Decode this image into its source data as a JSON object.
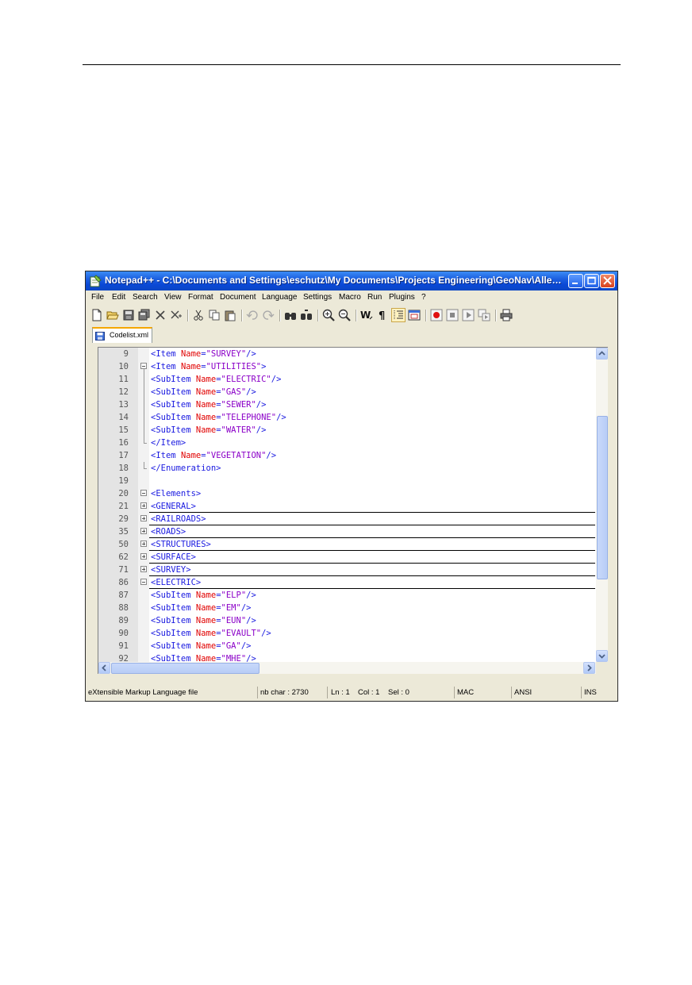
{
  "window": {
    "title": "Notepad++ - C:\\Documents and Settings\\eschutz\\My Documents\\Projects Engineering\\GeoNav\\Allen\\Man..."
  },
  "menu": [
    "File",
    "Edit",
    "Search",
    "View",
    "Format",
    "Document",
    "Language",
    "Settings",
    "Macro",
    "Run",
    "Plugins",
    "?"
  ],
  "toolbar_icons": [
    "new-icon",
    "open-icon",
    "save-icon",
    "save-all-icon",
    "close-icon",
    "close-all-icon",
    "cut-icon",
    "copy-icon",
    "paste-icon",
    "undo-icon",
    "redo-icon",
    "find-icon",
    "replace-icon",
    "zoom-in-icon",
    "zoom-out-icon",
    "wrap-icon",
    "show-all-chars-icon",
    "indent-guide-icon",
    "user-lang-icon",
    "record-macro-icon",
    "stop-record-icon",
    "play-macro-icon",
    "run-multiple-icon",
    "print-icon"
  ],
  "tab": {
    "label": "Codelist.xml"
  },
  "editor": {
    "lines": [
      {
        "n": "9",
        "indent": "",
        "tag_open": "<Item ",
        "attr": "Name",
        "eq": "=",
        "val": "\"SURVEY\"",
        "tag_close": "/>"
      },
      {
        "n": "10",
        "indent": "",
        "tag_open": "<Item ",
        "attr": "Name",
        "eq": "=",
        "val": "\"UTILITIES\"",
        "tag_close": ">"
      },
      {
        "n": "11",
        "indent": "",
        "tag_open": "<SubItem ",
        "attr": "Name",
        "eq": "=",
        "val": "\"ELECTRIC\"",
        "tag_close": "/>"
      },
      {
        "n": "12",
        "indent": "",
        "tag_open": "<SubItem ",
        "attr": "Name",
        "eq": "=",
        "val": "\"GAS\"",
        "tag_close": "/>"
      },
      {
        "n": "13",
        "indent": "",
        "tag_open": "<SubItem ",
        "attr": "Name",
        "eq": "=",
        "val": "\"SEWER\"",
        "tag_close": "/>"
      },
      {
        "n": "14",
        "indent": "",
        "tag_open": "<SubItem ",
        "attr": "Name",
        "eq": "=",
        "val": "\"TELEPHONE\"",
        "tag_close": "/>"
      },
      {
        "n": "15",
        "indent": "",
        "tag_open": "<SubItem ",
        "attr": "Name",
        "eq": "=",
        "val": "\"WATER\"",
        "tag_close": "/>"
      },
      {
        "n": "16",
        "indent": "",
        "tag_open": "</Item>",
        "attr": "",
        "eq": "",
        "val": "",
        "tag_close": ""
      },
      {
        "n": "17",
        "indent": "",
        "tag_open": "<Item ",
        "attr": "Name",
        "eq": "=",
        "val": "\"VEGETATION\"",
        "tag_close": "/>"
      },
      {
        "n": "18",
        "indent": "",
        "tag_open": "</Enumeration>",
        "attr": "",
        "eq": "",
        "val": "",
        "tag_close": ""
      },
      {
        "n": "19",
        "indent": "",
        "tag_open": "",
        "attr": "",
        "eq": "",
        "val": "",
        "tag_close": ""
      },
      {
        "n": "20",
        "indent": "",
        "tag_open": "<Elements>",
        "attr": "",
        "eq": "",
        "val": "",
        "tag_close": ""
      },
      {
        "n": "21",
        "indent": "",
        "tag_open": "<GENERAL>",
        "attr": "",
        "eq": "",
        "val": "",
        "tag_close": ""
      },
      {
        "n": "29",
        "indent": "",
        "tag_open": "<RAILROADS>",
        "attr": "",
        "eq": "",
        "val": "",
        "tag_close": ""
      },
      {
        "n": "35",
        "indent": "",
        "tag_open": "<ROADS>",
        "attr": "",
        "eq": "",
        "val": "",
        "tag_close": ""
      },
      {
        "n": "50",
        "indent": "",
        "tag_open": "<STRUCTURES>",
        "attr": "",
        "eq": "",
        "val": "",
        "tag_close": ""
      },
      {
        "n": "62",
        "indent": "",
        "tag_open": "<SURFACE>",
        "attr": "",
        "eq": "",
        "val": "",
        "tag_close": ""
      },
      {
        "n": "71",
        "indent": "",
        "tag_open": "<SURVEY>",
        "attr": "",
        "eq": "",
        "val": "",
        "tag_close": ""
      },
      {
        "n": "86",
        "indent": "",
        "tag_open": "<ELECTRIC>",
        "attr": "",
        "eq": "",
        "val": "",
        "tag_close": ""
      },
      {
        "n": "87",
        "indent": "",
        "tag_open": "<SubItem ",
        "attr": "Name",
        "eq": "=",
        "val": "\"ELP\"",
        "tag_close": "/>"
      },
      {
        "n": "88",
        "indent": "",
        "tag_open": "<SubItem ",
        "attr": "Name",
        "eq": "=",
        "val": "\"EM\"",
        "tag_close": "/>"
      },
      {
        "n": "89",
        "indent": "",
        "tag_open": "<SubItem ",
        "attr": "Name",
        "eq": "=",
        "val": "\"EUN\"",
        "tag_close": "/>"
      },
      {
        "n": "90",
        "indent": "",
        "tag_open": "<SubItem ",
        "attr": "Name",
        "eq": "=",
        "val": "\"EVAULT\"",
        "tag_close": "/>"
      },
      {
        "n": "91",
        "indent": "",
        "tag_open": "<SubItem ",
        "attr": "Name",
        "eq": "=",
        "val": "\"GA\"",
        "tag_close": "/>"
      },
      {
        "n": "92",
        "indent": "",
        "tag_open": "<SubItem ",
        "attr": "Name",
        "eq": "=",
        "val": "\"MHE\"",
        "tag_close": "/>"
      }
    ]
  },
  "status": {
    "file_type": "eXtensible Markup Language file",
    "nb_char": "nb char : 2730",
    "ln": "Ln : 1",
    "col": "Col : 1",
    "sel": "Sel : 0",
    "eol": "MAC",
    "encoding": "ANSI",
    "mode": "INS"
  }
}
